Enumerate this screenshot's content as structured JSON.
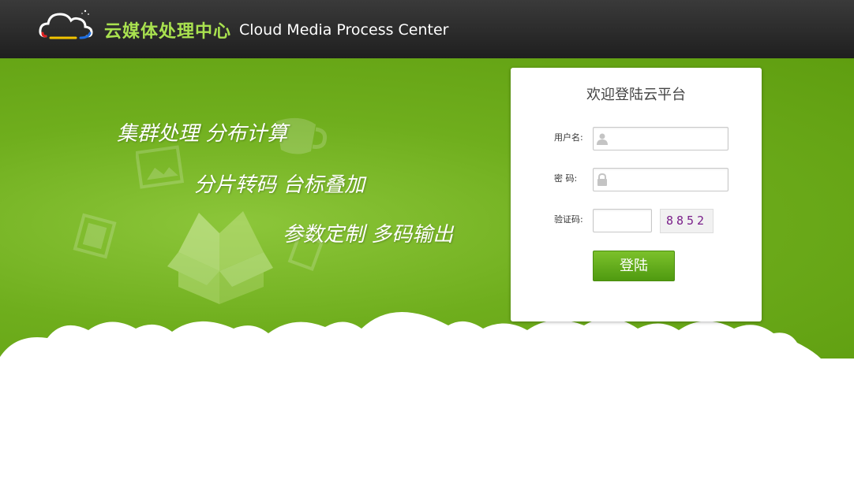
{
  "header": {
    "title_cn": "云媒体处理中心",
    "title_en": "Cloud Media Process Center",
    "logo_icon": "cloud-logo-icon"
  },
  "banner": {
    "slogans": [
      "集群处理  分布计算",
      "分片转码   台标叠加",
      "参数定制  多码输出"
    ],
    "decor_icons": [
      "box-icon",
      "image-icon",
      "film-icon",
      "coffee-cup-icon"
    ]
  },
  "login": {
    "title": "欢迎登陆云平台",
    "username_label": "用户名:",
    "password_label": "密    码:",
    "captcha_label": "验证码:",
    "username_value": "",
    "password_value": "",
    "captcha_value": "",
    "captcha_image_text": "8852",
    "submit_label": "登陆",
    "user_icon": "user-icon",
    "lock_icon": "lock-icon"
  },
  "colors": {
    "header_bg": "#2b2b2b",
    "brand_green": "#a9e24f",
    "banner_green": "#6fae1d",
    "button_green": "#5fa81a"
  }
}
